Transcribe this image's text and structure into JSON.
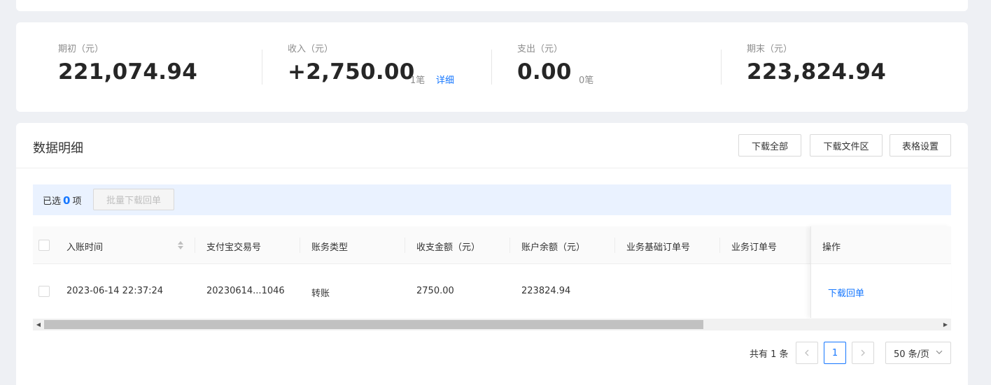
{
  "summary": {
    "opening": {
      "label": "期初（元）",
      "value": "221,074.94"
    },
    "income": {
      "label": "收入（元）",
      "value": "+2,750.00",
      "count": "1笔",
      "detail_link": "详细"
    },
    "expense": {
      "label": "支出（元）",
      "value": "0.00",
      "count": "0笔"
    },
    "closing": {
      "label": "期末（元）",
      "value": "223,824.94"
    }
  },
  "detail": {
    "title": "数据明细",
    "buttons": {
      "download_all": "下载全部",
      "download_area": "下载文件区",
      "table_settings": "表格设置"
    },
    "selection": {
      "prefix": "已选",
      "count": "0",
      "suffix": "项",
      "batch_download": "批量下载回单"
    },
    "columns": [
      "入账时间",
      "支付宝交易号",
      "账务类型",
      "收支金额（元）",
      "账户余额（元）",
      "业务基础订单号",
      "业务订单号",
      "操作"
    ],
    "rows": [
      {
        "time": "2023-06-14 22:37:24",
        "trade_no": "20230614...1046",
        "type": "转账",
        "amount": "2750.00",
        "balance": "223824.94",
        "base_order": "",
        "order": "",
        "action": "下载回单"
      }
    ]
  },
  "pagination": {
    "total_text": "共有 1 条",
    "current_page": "1",
    "page_size": "50 条/页"
  },
  "colors": {
    "accent": "#1677ff",
    "selection_bg": "#eaf2ff",
    "page_bg": "#eef0f4"
  },
  "icons": [
    "sort-icon",
    "chevron-left-icon",
    "chevron-right-icon",
    "chevron-down-icon",
    "scroll-left-icon",
    "scroll-right-icon"
  ]
}
